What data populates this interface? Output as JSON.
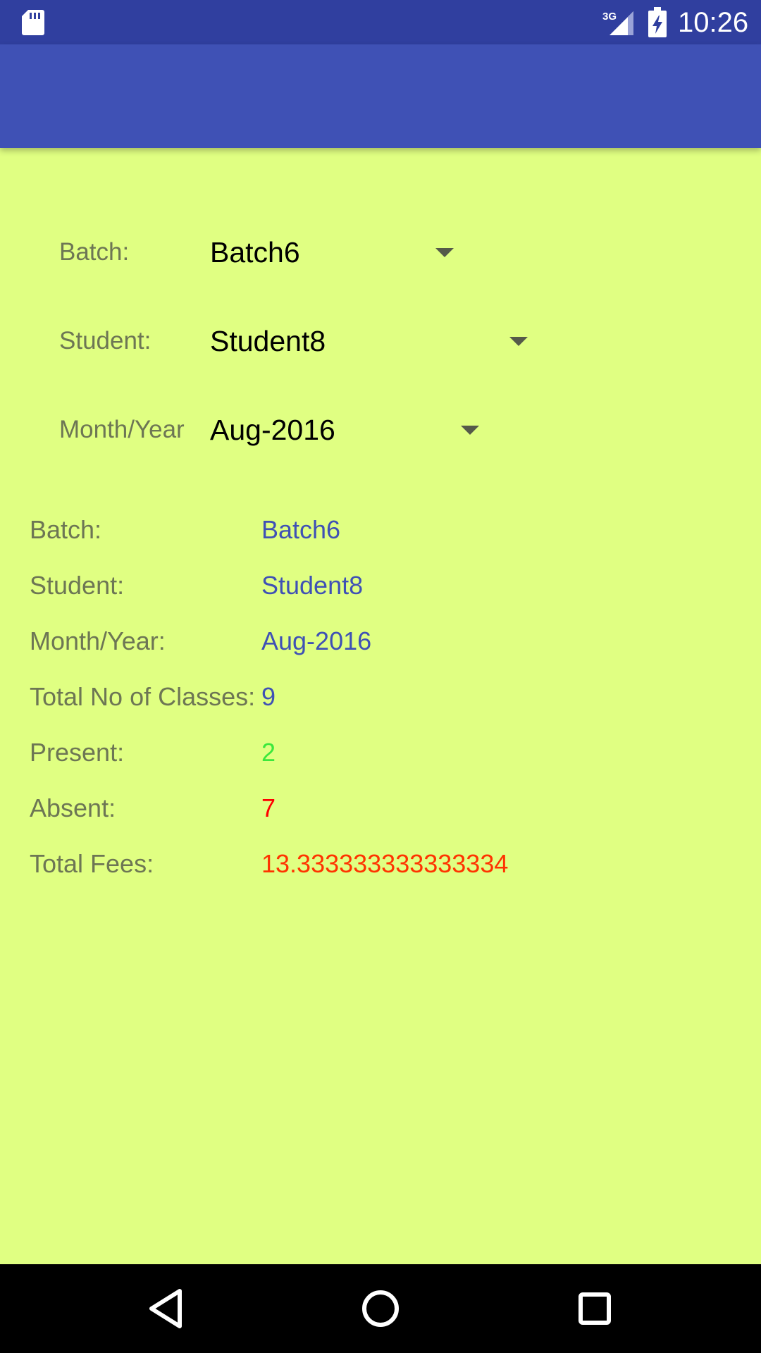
{
  "status_bar": {
    "time": "10:26",
    "network": "3G",
    "icons": [
      "sd-card-icon",
      "signal-icon",
      "battery-charging-icon"
    ]
  },
  "filters": {
    "batch": {
      "label": "Batch:",
      "value": "Batch6"
    },
    "student": {
      "label": "Student:",
      "value": "Student8"
    },
    "month_year": {
      "label": "Month/Year",
      "value": "Aug-2016"
    }
  },
  "summary": {
    "batch": {
      "label": "Batch:",
      "value": "Batch6"
    },
    "student": {
      "label": "Student:",
      "value": "Student8"
    },
    "month_year": {
      "label": "Month/Year:",
      "value": "Aug-2016"
    },
    "total_classes": {
      "label": "Total No of Classes:",
      "value": "9"
    },
    "present": {
      "label": "Present:",
      "value": "2"
    },
    "absent": {
      "label": "Absent:",
      "value": "7"
    },
    "total_fees": {
      "label": "Total Fees:",
      "value": "13.333333333333334"
    }
  },
  "colors": {
    "background": "#E0FF82",
    "app_bar": "#3F51B5",
    "status_bar": "#303F9F",
    "value_blue": "#3F51B5",
    "present_green": "#3CE83C",
    "absent_red": "#FF0000",
    "fees_red": "#FF3300"
  },
  "nav_bar": {
    "icons": [
      "back-icon",
      "home-icon",
      "recents-icon"
    ]
  }
}
